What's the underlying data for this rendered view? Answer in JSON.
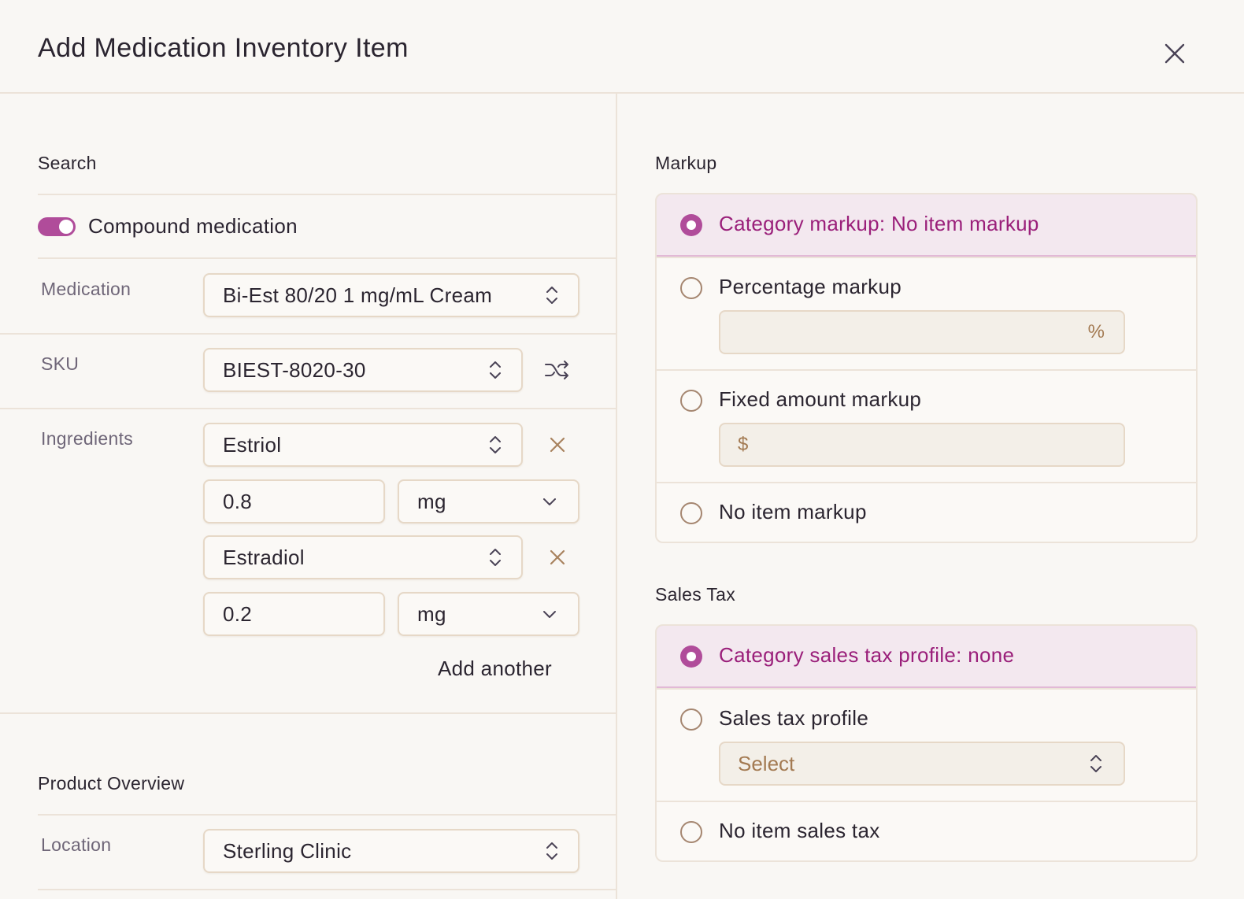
{
  "dialog": {
    "title": "Add Medication Inventory Item"
  },
  "search": {
    "section_title": "Search",
    "compound_toggle_label": "Compound medication",
    "compound_toggle_on": true,
    "medication": {
      "label": "Medication",
      "value": "Bi-Est 80/20 1 mg/mL Cream"
    },
    "sku": {
      "label": "SKU",
      "value": "BIEST-8020-30"
    },
    "ingredients": {
      "label": "Ingredients",
      "items": [
        {
          "name": "Estriol",
          "amount": "0.8",
          "unit": "mg"
        },
        {
          "name": "Estradiol",
          "amount": "0.2",
          "unit": "mg"
        }
      ],
      "add_another_label": "Add another"
    }
  },
  "product_overview": {
    "section_title": "Product Overview",
    "location": {
      "label": "Location",
      "value": "Sterling Clinic"
    }
  },
  "markup": {
    "section_title": "Markup",
    "options": [
      {
        "label": "Category markup: No item markup",
        "selected": true
      },
      {
        "label": "Percentage markup",
        "selected": false,
        "suffix": "%"
      },
      {
        "label": "Fixed amount markup",
        "selected": false,
        "prefix": "$"
      },
      {
        "label": "No item markup",
        "selected": false
      }
    ]
  },
  "sales_tax": {
    "section_title": "Sales Tax",
    "options": [
      {
        "label": "Category sales tax profile: none",
        "selected": true
      },
      {
        "label": "Sales tax profile",
        "selected": false,
        "select_placeholder": "Select"
      },
      {
        "label": "No item sales tax",
        "selected": false
      }
    ]
  },
  "colors": {
    "accent": "#b04c9a",
    "accent_text": "#9a1f7a",
    "selected_bg": "#f3e8ef",
    "border": "#e6d8c7"
  }
}
